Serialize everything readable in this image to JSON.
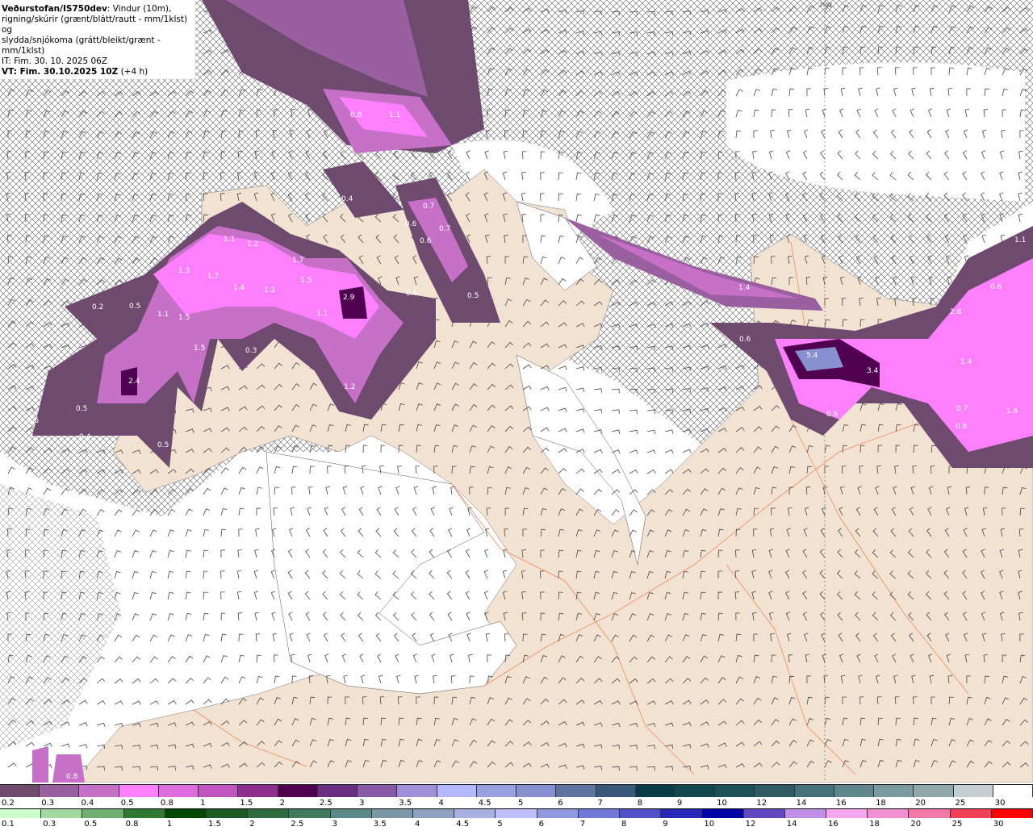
{
  "header": {
    "source": "Veðurstofan/IS750dev",
    "description_1": ": Vindur (10m),",
    "description_2": "rigning/skúrir (grænt/blátt/rautt - mm/1klst) og",
    "description_3": "slydda/snjókoma (grátt/bleikt/grænt - mm/1klst)",
    "init_time": "IT: Fim. 30. 10. 2025 06Z",
    "valid_time": "VT: Fim. 30.10.2025 10Z",
    "lead": " (+4 h)"
  },
  "map": {
    "meridian_label": "20W",
    "land_color": "#f2e2d2",
    "sea_color": "#ffffff",
    "road_color": "#f08a60",
    "precip_labels": [
      "0.8",
      "1.1",
      "0.4",
      "0.7",
      "0.6",
      "0.6",
      "0.7",
      "1.1",
      "1.2",
      "1.3",
      "1.7",
      "1.4",
      "1.2",
      "1.7",
      "1.5",
      "2.9",
      "0.6",
      "0.5",
      "0.2",
      "0.5",
      "1.1",
      "1.5",
      "1.5",
      "1.1",
      "0.3",
      "2.4",
      "0.5",
      "0.5",
      "0.4",
      "0.5",
      "1.2",
      "1.4",
      "0.6",
      "5.4",
      "3.4",
      "0.6",
      "2.8",
      "1.4",
      "0.7",
      "0.8",
      "1.6",
      "1.1",
      "0.6",
      "0.8"
    ]
  },
  "legend_snow": {
    "labels": [
      "0.2",
      "0.3",
      "0.4",
      "0.5",
      "0.8",
      "1",
      "1.5",
      "2",
      "2.5",
      "3",
      "3.5",
      "4",
      "4.5",
      "5",
      "6",
      "7",
      "8",
      "9",
      "10",
      "12",
      "14",
      "16",
      "18",
      "20",
      "25",
      "30"
    ],
    "colors": [
      "#6e4a6e",
      "#9a5f9e",
      "#c670c8",
      "#ff80ff",
      "#de6ee0",
      "#c055c0",
      "#902e90",
      "#500050",
      "#6a2e80",
      "#8a5aaa",
      "#a090d8",
      "#b4b8ff",
      "#98a0e0",
      "#8890d0",
      "#5e74a0",
      "#3a5878",
      "#0a3c48",
      "#124850",
      "#1e5058",
      "#2e5c62",
      "#46707a",
      "#5e868c",
      "#7a9aa0",
      "#90a8ac",
      "#c4ced2",
      "#ffffff"
    ]
  },
  "legend_rain": {
    "labels": [
      "0.1",
      "0.3",
      "0.5",
      "0.8",
      "1",
      "1.5",
      "2",
      "2.5",
      "3",
      "3.5",
      "4",
      "4.5",
      "5",
      "6",
      "7",
      "8",
      "9",
      "10",
      "12",
      "14",
      "16",
      "18",
      "20",
      "25",
      "30"
    ],
    "colors": [
      "#ccffcc",
      "#a0d8a0",
      "#70b070",
      "#307830",
      "#004800",
      "#1c5c24",
      "#2c6c40",
      "#407a5c",
      "#5c8888",
      "#7a98a8",
      "#90a0c0",
      "#a8b0e0",
      "#c0c0ff",
      "#9098e0",
      "#7078d8",
      "#5050c8",
      "#2828b8",
      "#0000a8",
      "#6048c0",
      "#c090e8",
      "#f4a8f0",
      "#f090d0",
      "#f478a8",
      "#f04058",
      "#ff0000"
    ]
  }
}
